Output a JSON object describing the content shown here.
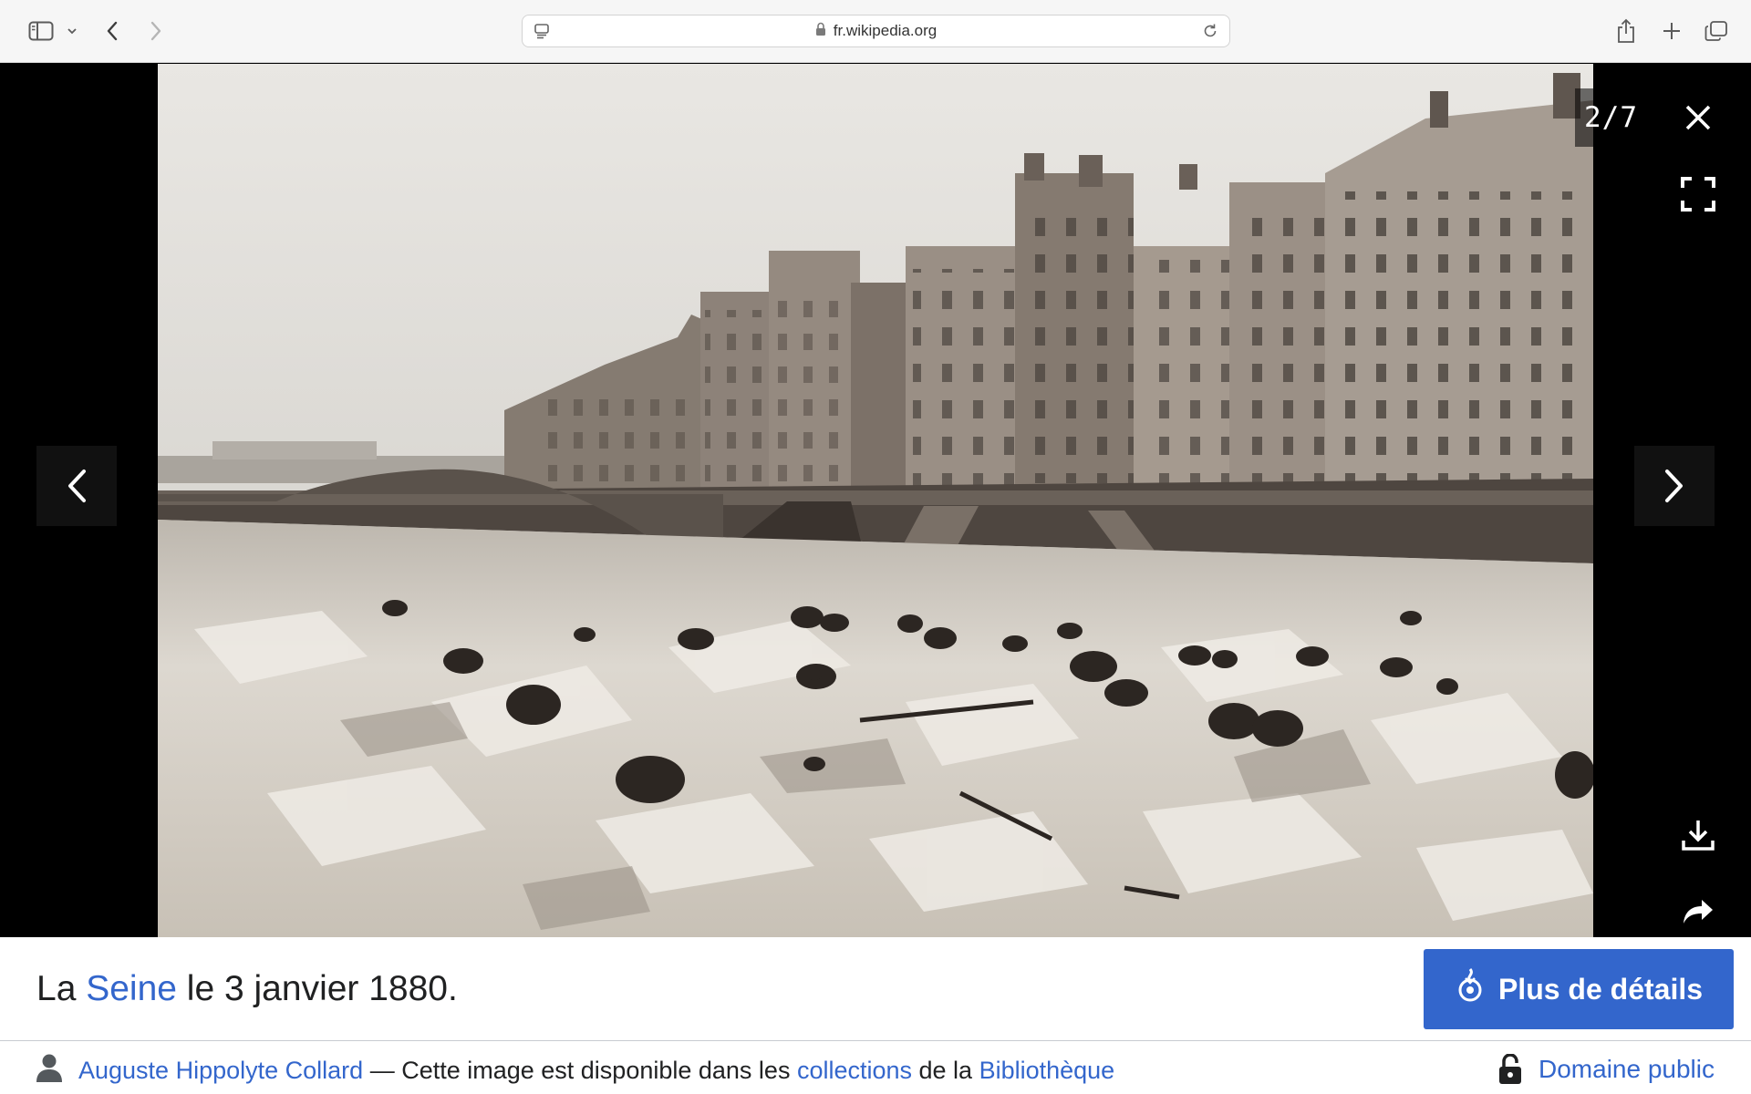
{
  "browser": {
    "url": "fr.wikipedia.org"
  },
  "viewer": {
    "counter": "2/7"
  },
  "caption": {
    "title_prefix": "La ",
    "title_link": "Seine",
    "title_suffix": " le 3 janvier 1880."
  },
  "details_button": {
    "label": "Plus de détails"
  },
  "credits": {
    "author": "Auguste Hippolyte Collard",
    "text_1": " — Cette image est disponible dans les ",
    "link_collections": "collections",
    "text_2": " de la ",
    "link_library": "Bibliothèque"
  },
  "license": {
    "label": "Domaine public"
  },
  "colors": {
    "accent": "#3366cc",
    "toolbar_bg": "#f6f6f6"
  }
}
